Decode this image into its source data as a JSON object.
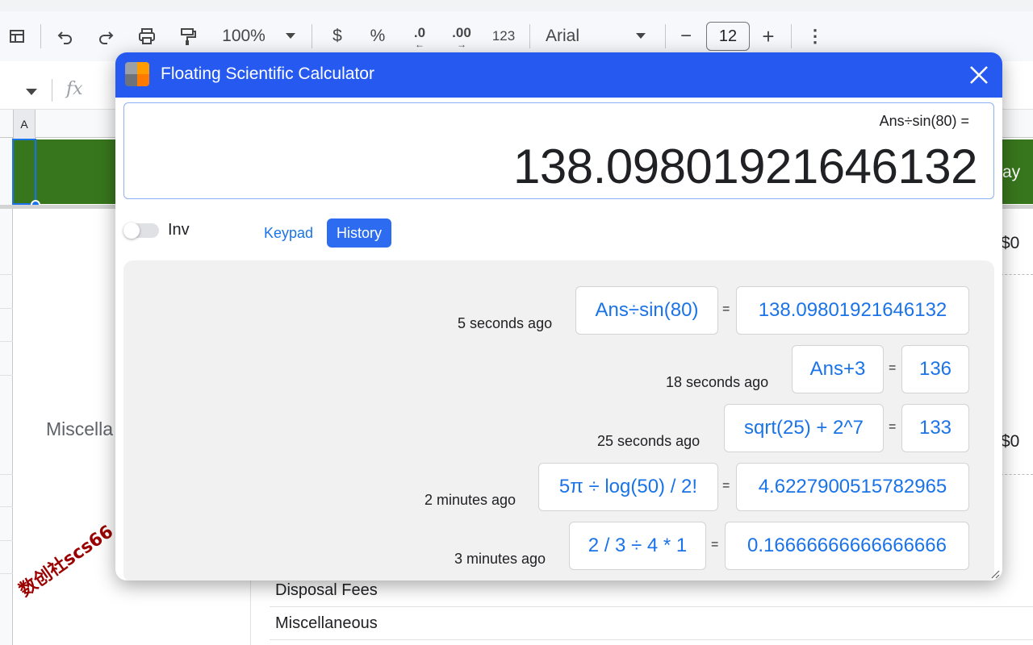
{
  "toolbar": {
    "zoom": "100%",
    "currency_symbol": "$",
    "percent_symbol": "%",
    "decrease_decimal": ".0",
    "increase_decimal": ".00",
    "number_format": "123",
    "font_name": "Arial",
    "font_size": "12",
    "minus": "−",
    "plus": "+",
    "more": "⋮"
  },
  "formula_bar": {
    "fx": "fx"
  },
  "sheet": {
    "column_a": "A",
    "header_partial": "ay",
    "misc_partial": "Miscella",
    "dollar_1": "$0",
    "dollar_2": "$0",
    "row_disposal": "Disposal Fees",
    "row_misc": "Miscellaneous",
    "watermark": "数创社scs66"
  },
  "calculator": {
    "title": "Floating Scientific Calculator",
    "display_expression": "Ans÷sin(80) =",
    "display_result": "138.09801921646132",
    "inv_label": "Inv",
    "inv_on": false,
    "tabs": {
      "keypad": "Keypad",
      "history": "History",
      "active": "History"
    },
    "history": [
      {
        "time": "5 seconds ago",
        "expression": "Ans÷sin(80)",
        "equals": "=",
        "result": "138.09801921646132"
      },
      {
        "time": "18 seconds ago",
        "expression": "Ans+3",
        "equals": "=",
        "result": "136"
      },
      {
        "time": "25 seconds ago",
        "expression": "sqrt(25) + 2^7",
        "equals": "=",
        "result": "133"
      },
      {
        "time": "2 minutes ago",
        "expression": "5π ÷ log(50) / 2!",
        "equals": "=",
        "result": "4.6227900515782965"
      },
      {
        "time": "3 minutes ago",
        "expression": "2 / 3 ÷ 4 * 1",
        "equals": "=",
        "result": "0.16666666666666666"
      }
    ]
  },
  "colors": {
    "title_bar": "#2659f0",
    "accent": "#1a73e8",
    "sheet_header_green": "#38761d"
  }
}
